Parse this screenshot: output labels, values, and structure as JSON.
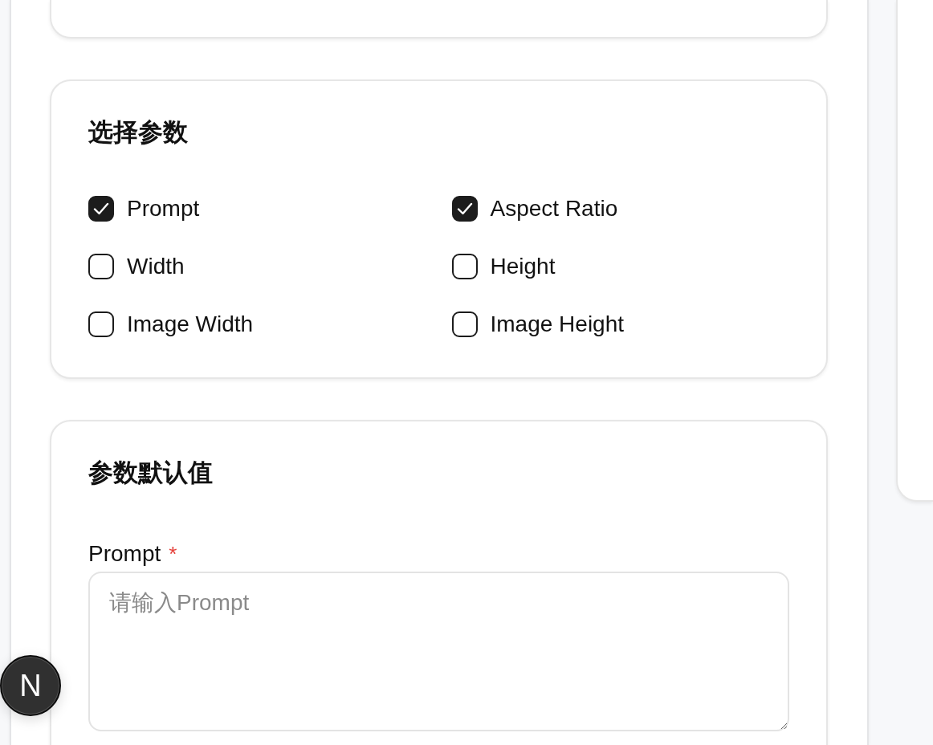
{
  "sections": [
    {
      "kind": "checkbox_grid",
      "title": "选择参数",
      "options": [
        {
          "label": "Prompt",
          "checked": true
        },
        {
          "label": "Aspect Ratio",
          "checked": true
        },
        {
          "label": "Width",
          "checked": false
        },
        {
          "label": "Height",
          "checked": false
        },
        {
          "label": "Image Width",
          "checked": false
        },
        {
          "label": "Image Height",
          "checked": false
        }
      ]
    },
    {
      "kind": "fields",
      "title": "参数默认值",
      "fields": [
        {
          "label": "Prompt",
          "required": true,
          "required_mark": "*",
          "placeholder": "请输入Prompt"
        }
      ]
    }
  ],
  "floating_button": {
    "label": "N"
  }
}
